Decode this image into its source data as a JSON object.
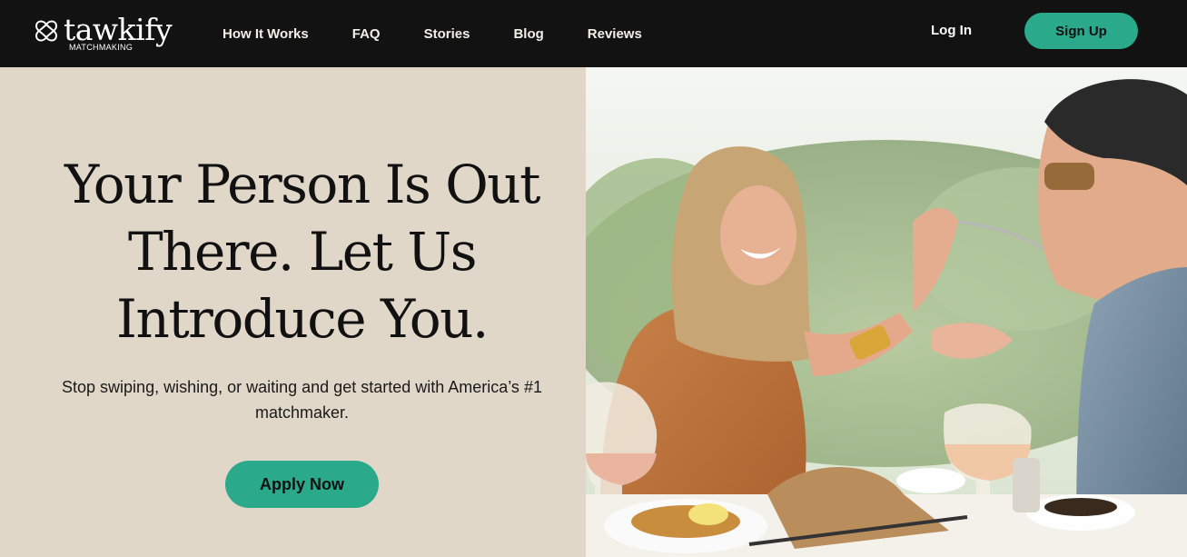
{
  "brand": {
    "name": "tawkify",
    "tagline": "MATCHMAKING",
    "logo_icon": "intertwined-hearts-icon"
  },
  "nav": {
    "links": [
      {
        "label": "How It Works"
      },
      {
        "label": "FAQ"
      },
      {
        "label": "Stories"
      },
      {
        "label": "Blog"
      },
      {
        "label": "Reviews"
      }
    ],
    "login_label": "Log In",
    "signup_label": "Sign Up"
  },
  "hero": {
    "title": "Your Person Is Out There. Let Us Introduce You.",
    "subtitle": "Stop swiping, wishing, or waiting and get started with America’s #1 matchmaker.",
    "cta_label": "Apply Now"
  },
  "colors": {
    "nav_background": "#121212",
    "accent": "#2aa98b",
    "hero_background": "#e1d7c8"
  }
}
